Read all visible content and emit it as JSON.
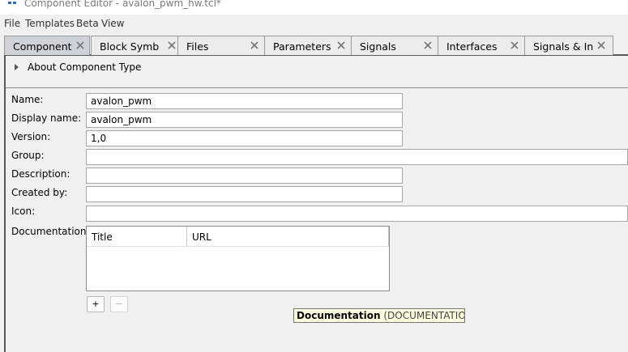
{
  "window": {
    "title": "Component Editor - avalon_pwm_hw.tcl*"
  },
  "menu": {
    "items": [
      "File",
      "Templates",
      "Beta",
      "View"
    ]
  },
  "tabs": [
    {
      "label": "Component",
      "active": true
    },
    {
      "label": "Block Symb",
      "active": false
    },
    {
      "label": "Files",
      "active": false
    },
    {
      "label": "Parameters",
      "active": false
    },
    {
      "label": "Signals",
      "active": false
    },
    {
      "label": "Interfaces",
      "active": false
    },
    {
      "label": "Signals & In",
      "active": false
    }
  ],
  "about": {
    "label": "About Component Type"
  },
  "form": {
    "name_label": "Name:",
    "name_value": "avalon_pwm",
    "display_name_label": "Display name:",
    "display_name_value": "avalon_pwm",
    "version_label": "Version:",
    "version_value": "1,0",
    "group_label": "Group:",
    "group_value": "",
    "description_label": "Description:",
    "description_value": "",
    "created_by_label": "Created by:",
    "created_by_value": "",
    "icon_label": "Icon:",
    "icon_value": "",
    "documentation_label": "Documentation:"
  },
  "documentation_table": {
    "columns": [
      "Title",
      "URL"
    ],
    "rows": []
  },
  "buttons": {
    "add": "+",
    "remove": "−"
  },
  "tooltip": {
    "title": "Documentation",
    "detail": "(DOCUMENTATION):"
  },
  "colors": {
    "active_tab": "#cfd3d8",
    "tooltip_bg": "#ffffe1",
    "app_icon": "#2f6db5"
  }
}
